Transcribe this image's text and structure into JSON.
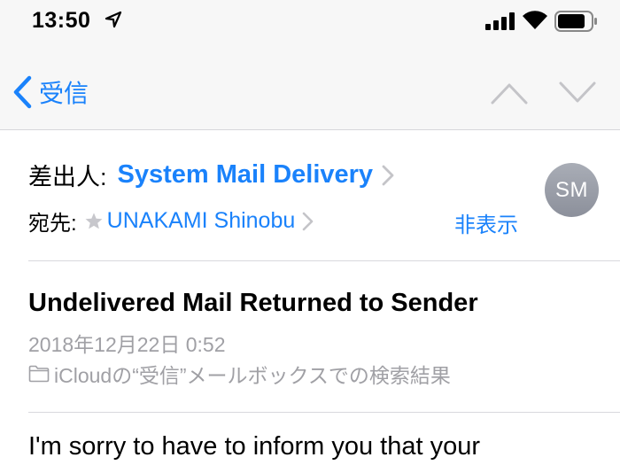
{
  "status_bar": {
    "time": "13:50",
    "icons": [
      "location-arrow-icon",
      "signal-bars-icon",
      "wifi-icon",
      "battery-icon"
    ]
  },
  "nav": {
    "back_label": "受信",
    "icons": [
      "chevron-left-icon",
      "chevron-up-icon",
      "chevron-down-icon"
    ]
  },
  "header": {
    "from_label": "差出人:",
    "from_name": "System Mail Delivery",
    "to_label": "宛先:",
    "to_name": "UNAKAMI Shinobu",
    "hide_label": "非表示",
    "avatar_initials": "SM"
  },
  "message": {
    "subject": "Undelivered Mail Returned to Sender",
    "date": "2018年12月22日 0:52",
    "folder_text": "iCloudの“受信”メールボックスでの検索結果",
    "body_first_line": "I'm sorry to have to inform you that your"
  },
  "colors": {
    "accent": "#1a82fb",
    "secondary_text": "#a0a0a5",
    "bar_background": "#f7f7f7",
    "avatar": "#9a9ea8"
  }
}
